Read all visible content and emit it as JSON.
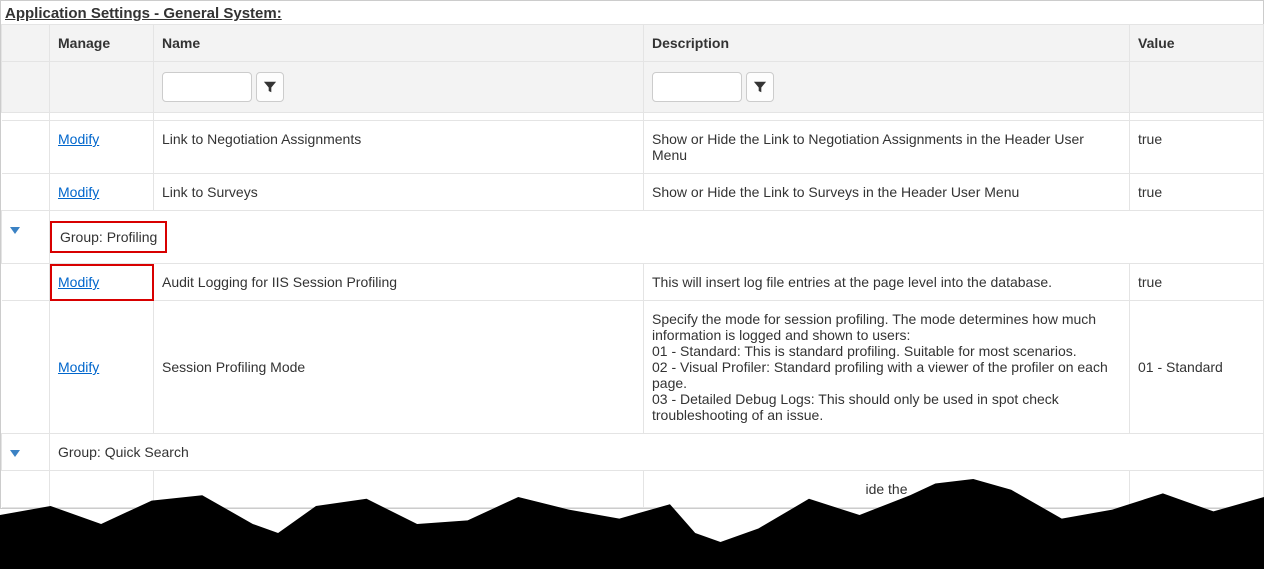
{
  "page_title": "Application Settings - General System:",
  "columns": {
    "manage": "Manage",
    "name": "Name",
    "description": "Description",
    "value": "Value"
  },
  "filters": {
    "name": "",
    "description": ""
  },
  "modify_label": "Modify",
  "groups": {
    "profiling": "Group: Profiling",
    "quicksearch": "Group: Quick Search"
  },
  "rows": {
    "negotiation": {
      "name": "Link to Negotiation Assignments",
      "description": "Show or Hide the Link to Negotiation Assignments in the Header User Menu",
      "value": "true"
    },
    "surveys": {
      "name": "Link to Surveys",
      "description": "Show or Hide the Link to Surveys in the Header User Menu",
      "value": "true"
    },
    "audit": {
      "name": "Audit Logging for IIS Session Profiling",
      "description": "This will insert log file entries at the page level into the database.",
      "value": "true"
    },
    "session_mode": {
      "name": "Session Profiling Mode",
      "description": "Specify the mode for session profiling. The mode determines how much information is logged and shown to users:\n01 - Standard: This is standard profiling. Suitable for most scenarios.\n02 - Visual Profiler: Standard profiling with a viewer of the profiler on each page.\n03 - Detailed Debug Logs: This should only be used in spot check troubleshooting of an issue.",
      "value": "01 - Standard"
    }
  },
  "partial_text": "ide the"
}
